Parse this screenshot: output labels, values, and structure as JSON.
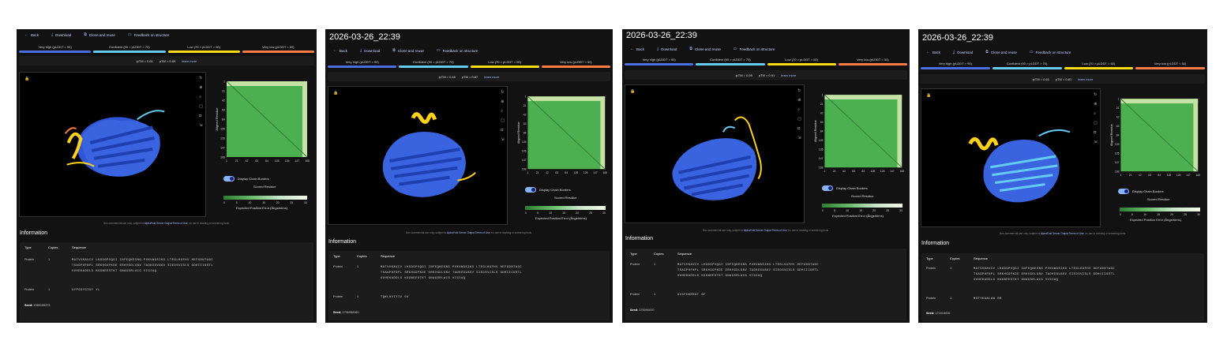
{
  "toolbar": {
    "back": "Back",
    "download": "Download",
    "clone": "Clone and reuse",
    "feedback": "Feedback on structure",
    "icons": [
      "arrow-left-icon",
      "download-icon",
      "clone-icon",
      "feedback-icon"
    ]
  },
  "legend": [
    {
      "label": "Very high (pLDDT > 90)",
      "color": "#4a6ee0"
    },
    {
      "label": "Confident (90 > pLDDT > 70)",
      "color": "#65cbf3"
    },
    {
      "label": "Low (70 > pLDDT > 50)",
      "color": "#ffdb13"
    },
    {
      "label": "Very low (pLDDT < 50)",
      "color": "#ff7d45"
    }
  ],
  "learn_more": "learn more",
  "pae": {
    "y_axis_label": "Aligned Residue",
    "x_axis_label": "Scored Residue",
    "ticks": [
      "1",
      "21",
      "42",
      "63",
      "84",
      "105",
      "126",
      "147",
      "168"
    ],
    "colorbar_ticks": [
      "0",
      "5",
      "10",
      "15",
      "20",
      "25",
      "30"
    ],
    "colorbar_label": "Expected Position Error (Ångströms)",
    "display_chain_borders": "Display Chain Borders"
  },
  "terms": {
    "prefix": "Non-commercial use only, subject to ",
    "link": "AlphaFold Server Output Terms of Use",
    "suffix": "; no use in docking or screening tools."
  },
  "info": {
    "heading": "Information",
    "col_type": "Type",
    "col_copies": "Copies",
    "col_sequence": "Sequence",
    "seed_label": "Seed:"
  },
  "panels": [
    {
      "title": "",
      "iptm": "ipTM = 0.61",
      "ptm": "pTM = 0.89",
      "seq_lines": [
        "MATVVKAVCV LKGDGPVQGI INFEQKESNG PVKVWGSIKG LTEGLHGFHV HEFGDNTAGC",
        "TSAGPHFNPL SRKHGGPKDE ERHVGDLGNV TADKDGVAKV SIEDSVISLS GDHCIIGRTL",
        "VVHEKADDLG KGGNEESTKT GNAGSRLACG VIGIAQ"
      ],
      "row2_seq": "GYPGGYGIGY YL",
      "seed": "1380155373"
    },
    {
      "title": "2026-03-26_22:39",
      "iptm": "ipTM = 0.46",
      "ptm": "pTM = 0.87",
      "seq_lines": [
        "MATVVKAVCV LKGDGPVQGI INFEQKESNG PVKVWGSIKG LTEGLHGFHV HEFGDNTAGC",
        "TSAGPHFNPL SRKHGGPKDE ERHVGDLGNV TADKDGVAKV SIEDSVISLS GDHCIIGRTL",
        "VVHEKADDLG KGGNEESTKT GNAGSRLACG VIGIAQ"
      ],
      "row2_seq": "TQKLHVIYIV GV",
      "seed": "1796958160"
    },
    {
      "title": "2026-03-26_22:39",
      "iptm": "ipTM = 0.59",
      "ptm": "pTM = 0.91",
      "seq_lines": [
        "MATVVKAVCV LKGDGPVQGI INFEQKESNG PVKVWGSIKG LTEGLHGFHV HEFGDNTAGC",
        "TSAGPHFNPL SRKHGGPKDE ERHVGDLGNV TADKDGVAKV SIEDSVISLS GDHCIIGRTL",
        "VVHEKADDLG KGGNEESTKT GNAGSRLACG VIGIAQ"
      ],
      "row2_seq": "GCGFKKRRGT GF",
      "seed": "376090870"
    },
    {
      "title": "2026-03-26_22:39",
      "iptm": "ipTM = 0.61",
      "ptm": "pTM = 0.81",
      "seq_lines": [
        "MATVVKAVCV LKGDGPVQGI INFEQKESNG PVKVWGSIKG LTEGLHGFHV HEFGDNTAGC",
        "TSAGPHFNPL SRKHGGPKDE ERHVGDLGNV TADKDGVAKV SIEDSVISLS GDHCIIGRTL",
        "VVHEKADDLG KGGNEESTKT GNAGSRLACG VIGIAQ"
      ],
      "row2_seq": "MSTYKGALAW RR",
      "seed": "171614020"
    }
  ],
  "row_type": "Protein",
  "row_copies": "1"
}
